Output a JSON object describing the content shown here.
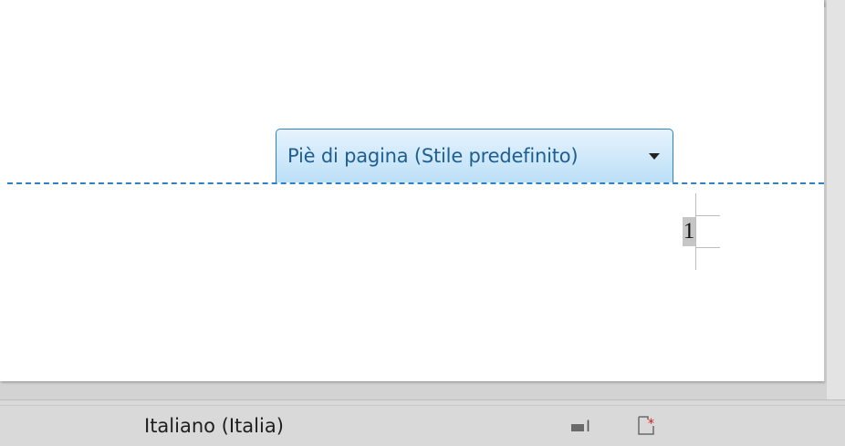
{
  "footer": {
    "tab_label": "Piè di pagina (Stile predefinito)",
    "dropdown_icon": "chevron-down-icon",
    "page_number": "1",
    "accent_color": "#2d82c6"
  },
  "status_bar": {
    "language": "Italiano (Italia)",
    "insert_mode_icon": "insert-mode-icon",
    "modified_icon": "document-modified-icon"
  }
}
